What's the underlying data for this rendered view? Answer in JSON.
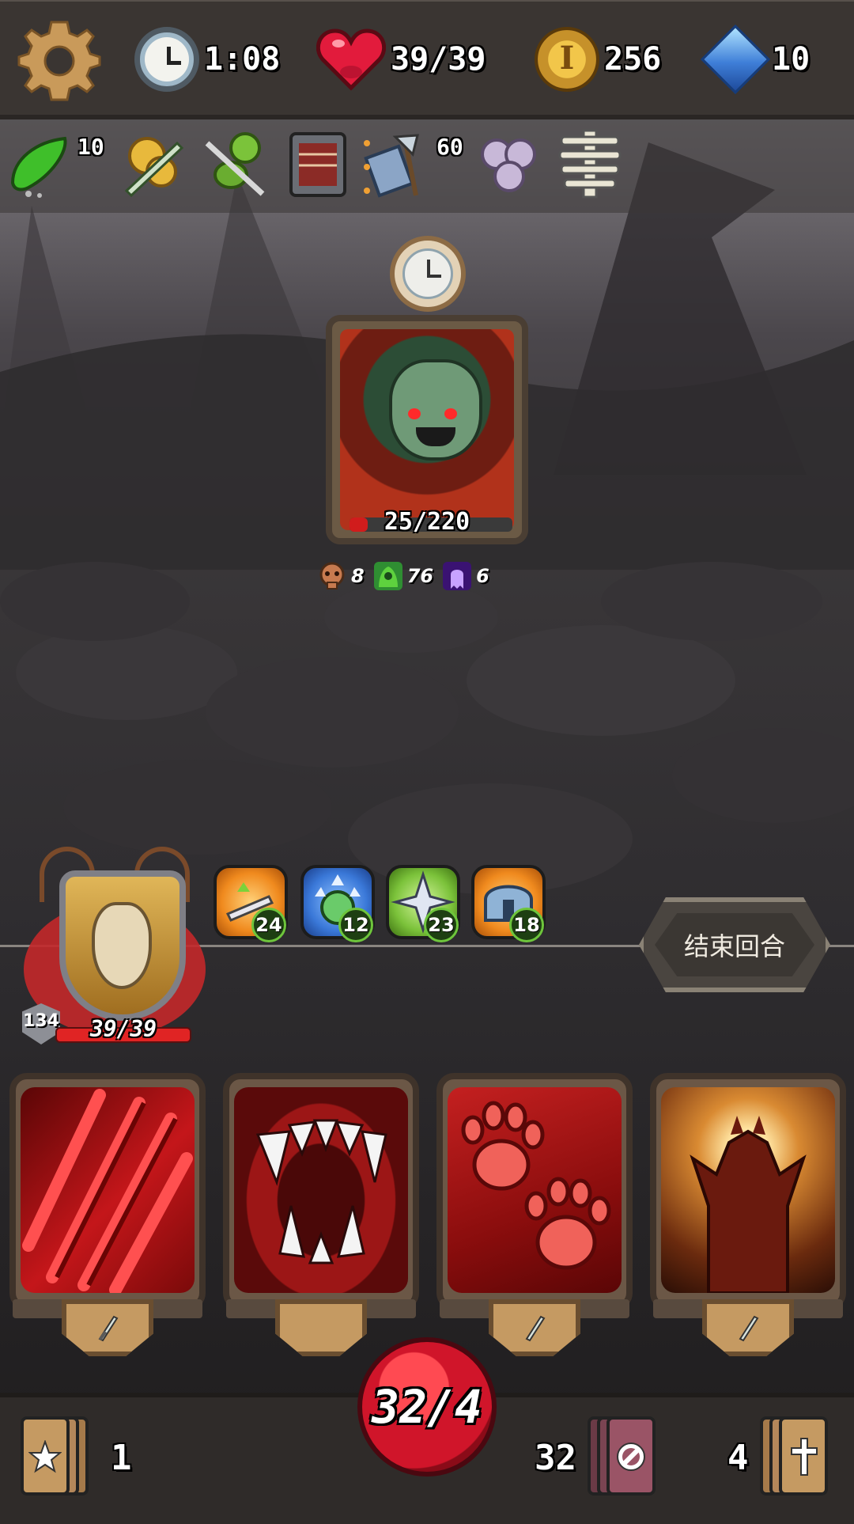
{
  "hud": {
    "timer": "1:08",
    "hp": "39/39",
    "gold": "256",
    "gems": "10",
    "icons": [
      "gear-icon",
      "clock-icon",
      "heart-icon",
      "coin-icon",
      "gem-icon"
    ]
  },
  "relics": [
    {
      "icon": "green-pepper-icon",
      "count": "10"
    },
    {
      "icon": "gold-sword-relic-icon",
      "count": ""
    },
    {
      "icon": "green-idol-knife-icon",
      "count": ""
    },
    {
      "icon": "ledger-book-icon",
      "count": ""
    },
    {
      "icon": "axe-book-icon",
      "count": "60"
    },
    {
      "icon": "swirl-shells-icon",
      "count": ""
    },
    {
      "icon": "spine-bone-icon",
      "count": ""
    }
  ],
  "enemy": {
    "hp_text": "25/220",
    "hp_fraction": 0.114,
    "intents": [
      {
        "icon": "skull-intent-icon",
        "value": "8",
        "color": "#c77a4f"
      },
      {
        "icon": "poison-intent-icon",
        "value": "76",
        "color": "#34a63a"
      },
      {
        "icon": "ghost-intent-icon",
        "value": "6",
        "color": "#7a2fd0"
      }
    ]
  },
  "player": {
    "block": "134",
    "hp_text": "39/39",
    "buffs": [
      {
        "icon": "sword-up-buff-icon",
        "value": "24",
        "color": "#f08a1e"
      },
      {
        "icon": "clock-up-buff-icon",
        "value": "12",
        "color": "#3a78d8"
      },
      {
        "icon": "shuriken-buff-icon",
        "value": "23",
        "color": "#7bc23a"
      },
      {
        "icon": "helmet-buff-icon",
        "value": "18",
        "color": "#f08a1e"
      }
    ]
  },
  "end_turn_label": "结束回合",
  "hand": [
    {
      "icon": "claw-slash-icon",
      "type": "attack"
    },
    {
      "icon": "fangs-bite-icon",
      "type": "attack"
    },
    {
      "icon": "paw-prints-icon",
      "type": "attack"
    },
    {
      "icon": "demon-rise-icon",
      "type": "attack"
    }
  ],
  "energy_text": "32/4",
  "piles": {
    "draw_count": "1",
    "discard_count": "32",
    "exhaust_count": "4"
  }
}
